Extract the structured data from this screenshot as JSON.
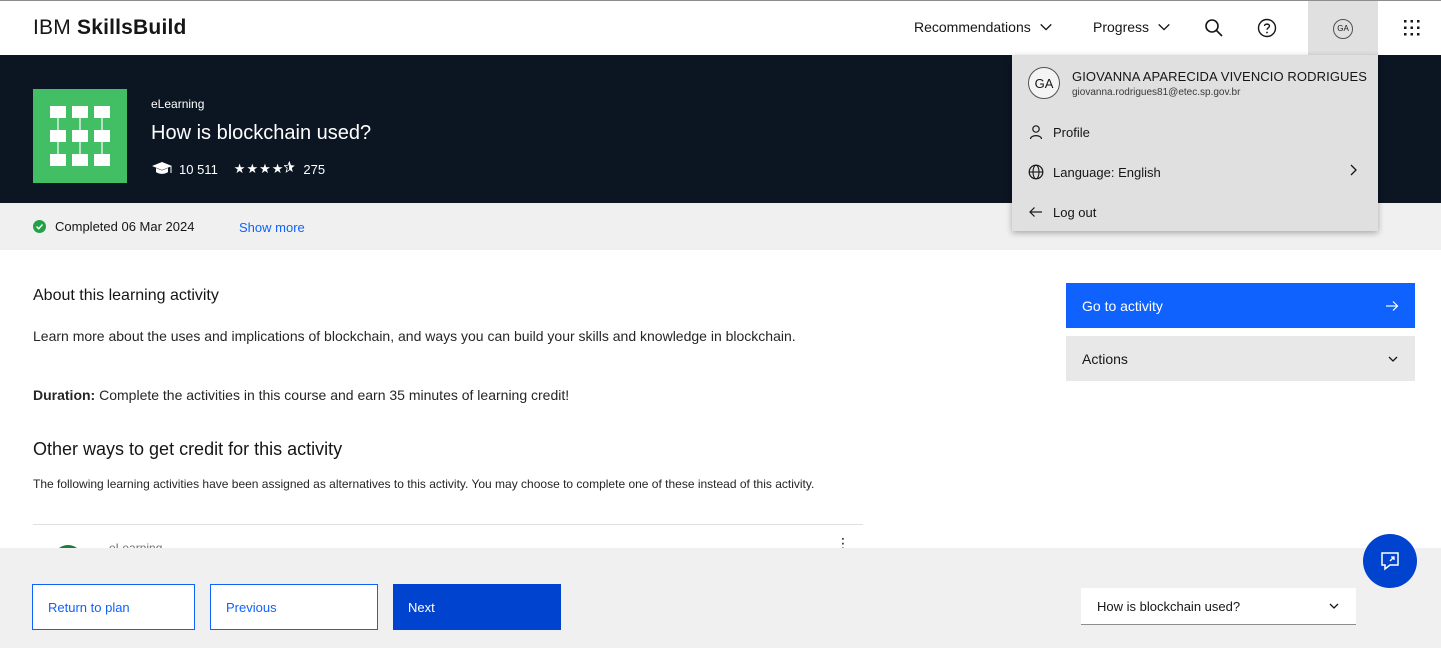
{
  "header": {
    "brand_prefix": "IBM",
    "brand_name": "SkillsBuild",
    "nav": [
      {
        "label": "Recommendations"
      },
      {
        "label": "Progress"
      }
    ],
    "avatar_initials": "GA"
  },
  "hero": {
    "type": "eLearning",
    "title": "How is blockchain used?",
    "enrolled": "10 511",
    "stars": "★★★★",
    "rating_count": "275"
  },
  "status": {
    "completed": "Completed 06 Mar 2024",
    "show_more": "Show more"
  },
  "main": {
    "about_heading": "About this learning activity",
    "description": "Learn more about the uses and implications of blockchain, and ways you can build your skills and knowledge in blockchain.",
    "duration_label": "Duration:",
    "duration_text": " Complete the activities in this course and earn 35 minutes of learning credit!",
    "other_heading": "Other ways to get credit for this activity",
    "alt_text": "The following learning activities have been assigned as alternatives to this activity. You may choose to complete one of these instead of this activity.",
    "peek_type": "eLearning"
  },
  "actions": {
    "go_label": "Go to activity",
    "actions_label": "Actions"
  },
  "footer": {
    "return_label": "Return to plan",
    "previous_label": "Previous",
    "next_label": "Next",
    "select_value": "How is blockchain used?"
  },
  "menu": {
    "initials": "GA",
    "name": "GIOVANNA APARECIDA VIVENCIO RODRIGUES",
    "email": "giovanna.rodrigues81@etec.sp.gov.br",
    "profile_label": "Profile",
    "language_label": "Language: English",
    "logout_label": "Log out"
  },
  "colors": {
    "primary": "#0f62fe",
    "next_button": "#0043ce",
    "hero_bg": "#0c1522",
    "tile_green": "#42be65",
    "success": "#24a148"
  },
  "icons": [
    "chevron-down-icon",
    "search-icon",
    "help-icon",
    "app-switcher-icon",
    "education-icon",
    "check-circle-icon",
    "arrow-right-icon",
    "user-icon",
    "globe-icon",
    "arrow-left-icon",
    "chevron-right-icon",
    "chat-icon",
    "overflow-menu-icon"
  ]
}
